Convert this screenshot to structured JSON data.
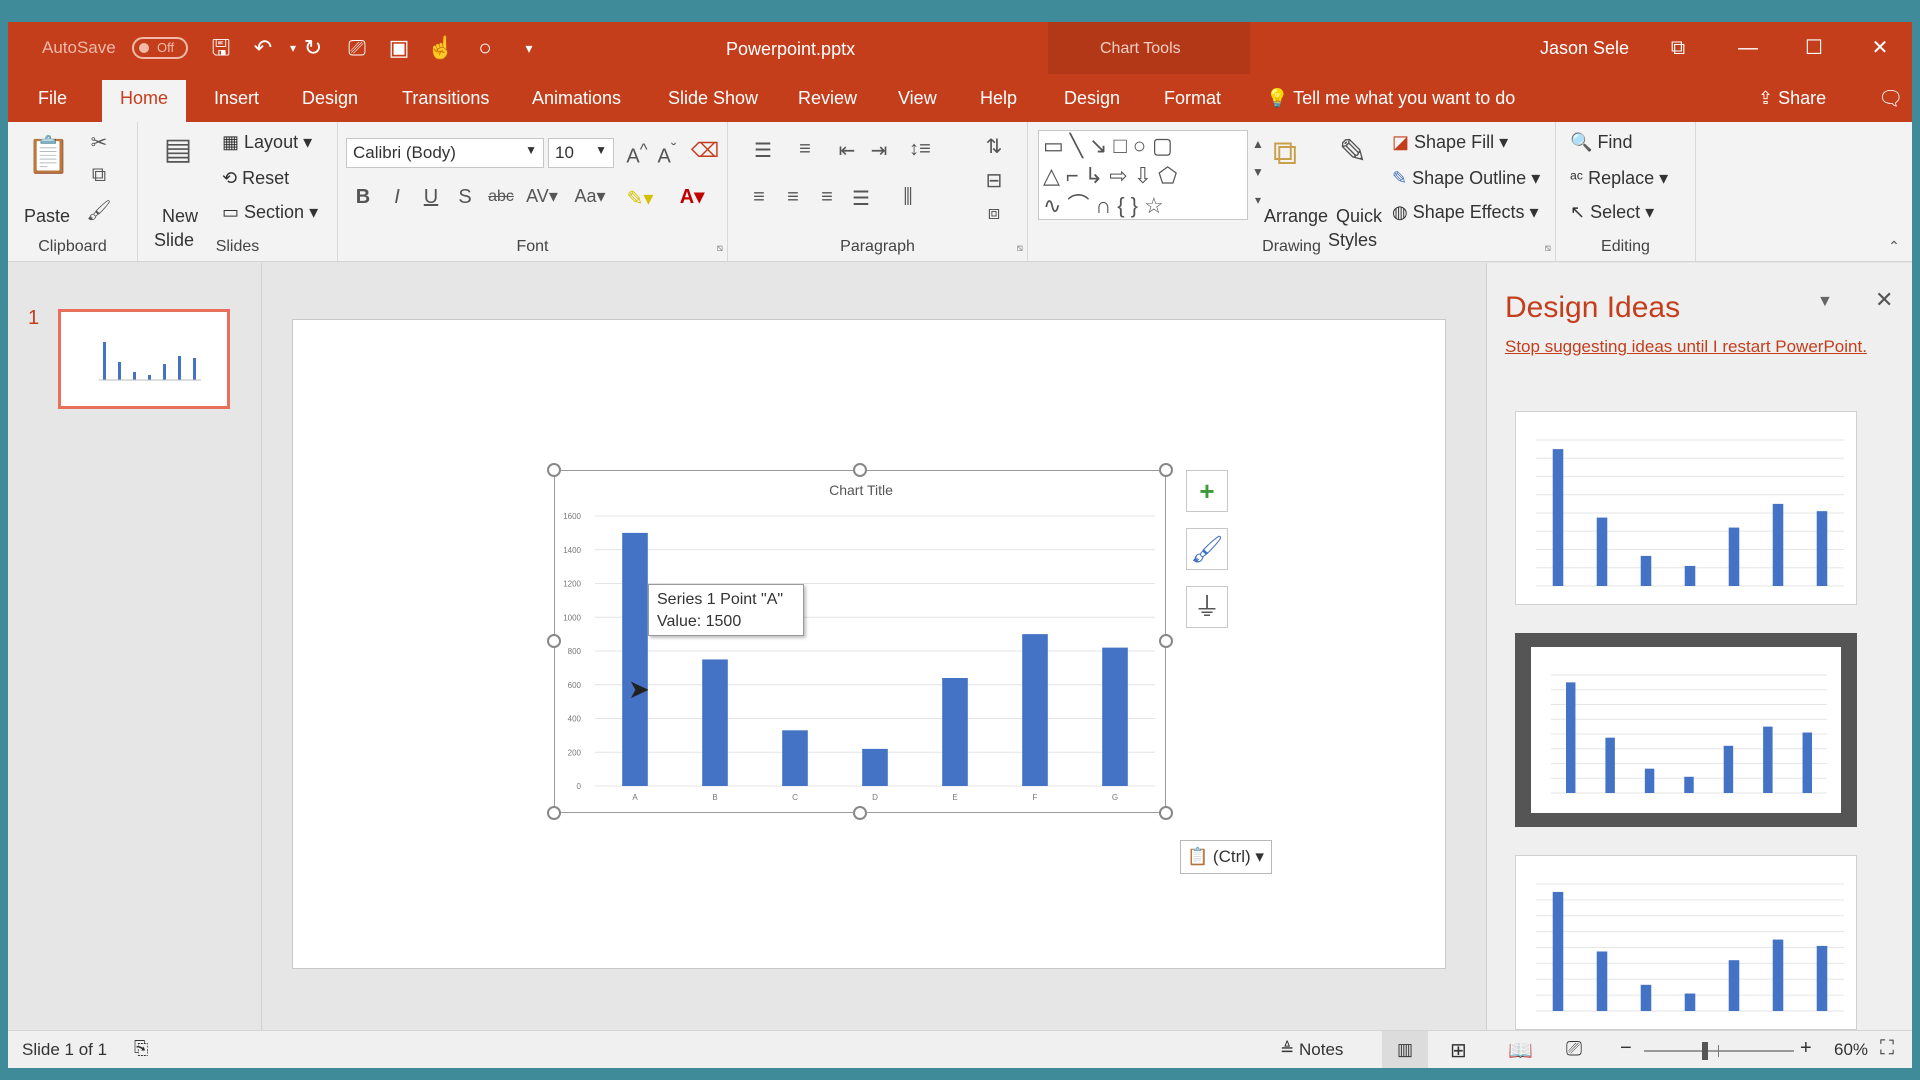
{
  "titlebar": {
    "autosave_label": "AutoSave",
    "autosave_state": "Off",
    "document": "Powerpoint.pptx",
    "context_group": "Chart Tools",
    "user": "Jason Sele"
  },
  "tabs": [
    "File",
    "Home",
    "Insert",
    "Design",
    "Transitions",
    "Animations",
    "Slide Show",
    "Review",
    "View",
    "Help",
    "Design",
    "Format"
  ],
  "active_tab": "Home",
  "tell_me": "Tell me what you want to do",
  "share": "Share",
  "ribbon": {
    "clipboard": {
      "paste": "Paste",
      "label": "Clipboard"
    },
    "slides": {
      "new_slide_1": "New",
      "new_slide_2": "Slide",
      "layout": "Layout",
      "reset": "Reset",
      "section": "Section",
      "label": "Slides"
    },
    "font": {
      "name": "Calibri (Body)",
      "size": "10",
      "label": "Font"
    },
    "paragraph": {
      "label": "Paragraph"
    },
    "drawing": {
      "arrange": "Arrange",
      "quick_1": "Quick",
      "quick_2": "Styles",
      "shape_fill": "Shape Fill",
      "shape_outline": "Shape Outline",
      "shape_effects": "Shape Effects",
      "label": "Drawing"
    },
    "editing": {
      "find": "Find",
      "replace": "Replace",
      "select": "Select",
      "label": "Editing"
    }
  },
  "thumbs": {
    "slide_number": "1"
  },
  "chart_data": {
    "type": "bar",
    "title": "Chart Title",
    "categories": [
      "A",
      "B",
      "C",
      "D",
      "E",
      "F",
      "G"
    ],
    "values": [
      1500,
      750,
      330,
      220,
      640,
      900,
      820
    ],
    "ylim": [
      0,
      1600
    ],
    "yticks": [
      "0",
      "200",
      "400",
      "600",
      "800",
      "1000",
      "1200",
      "1400",
      "1600"
    ],
    "grid": true,
    "color": "#4472c4"
  },
  "tooltip": {
    "line1": "Series 1 Point \"A\"",
    "line2": "Value: 1500"
  },
  "paste_options": "(Ctrl)",
  "design_ideas": {
    "title": "Design Ideas",
    "link": "Stop suggesting ideas until I restart PowerPoint."
  },
  "status": {
    "slide": "Slide 1 of 1",
    "notes": "Notes",
    "zoom": "60%"
  },
  "colors": {
    "accent": "#c43e1c",
    "bar": "#4472c4"
  }
}
